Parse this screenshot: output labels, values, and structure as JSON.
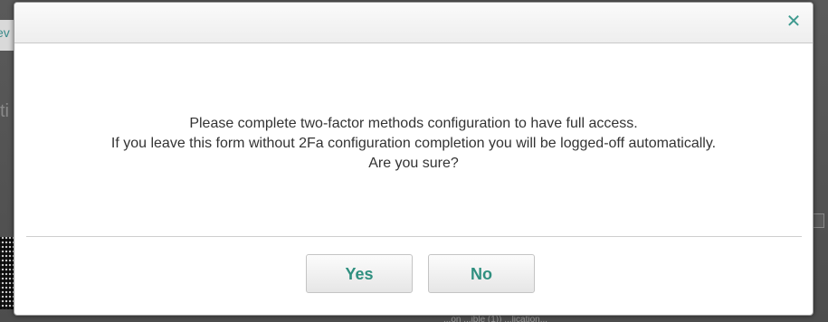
{
  "background": {
    "tab_fragment": "ev",
    "edge_fragment": "ti",
    "bottom_fragment": "...on ...ible (1)) ...lication..."
  },
  "dialog": {
    "close_glyph": "✕",
    "message_lines": [
      "Please complete two-factor methods configuration to have full access.",
      "If you leave this form without 2Fa configuration completion you will be logged-off automatically.",
      "Are you sure?"
    ],
    "buttons": {
      "yes_label": "Yes",
      "no_label": "No"
    }
  },
  "colors": {
    "accent": "#2f8f7f",
    "close_icon": "#3f9a8f",
    "text": "#333333",
    "overlay": "#4d4d4d"
  }
}
